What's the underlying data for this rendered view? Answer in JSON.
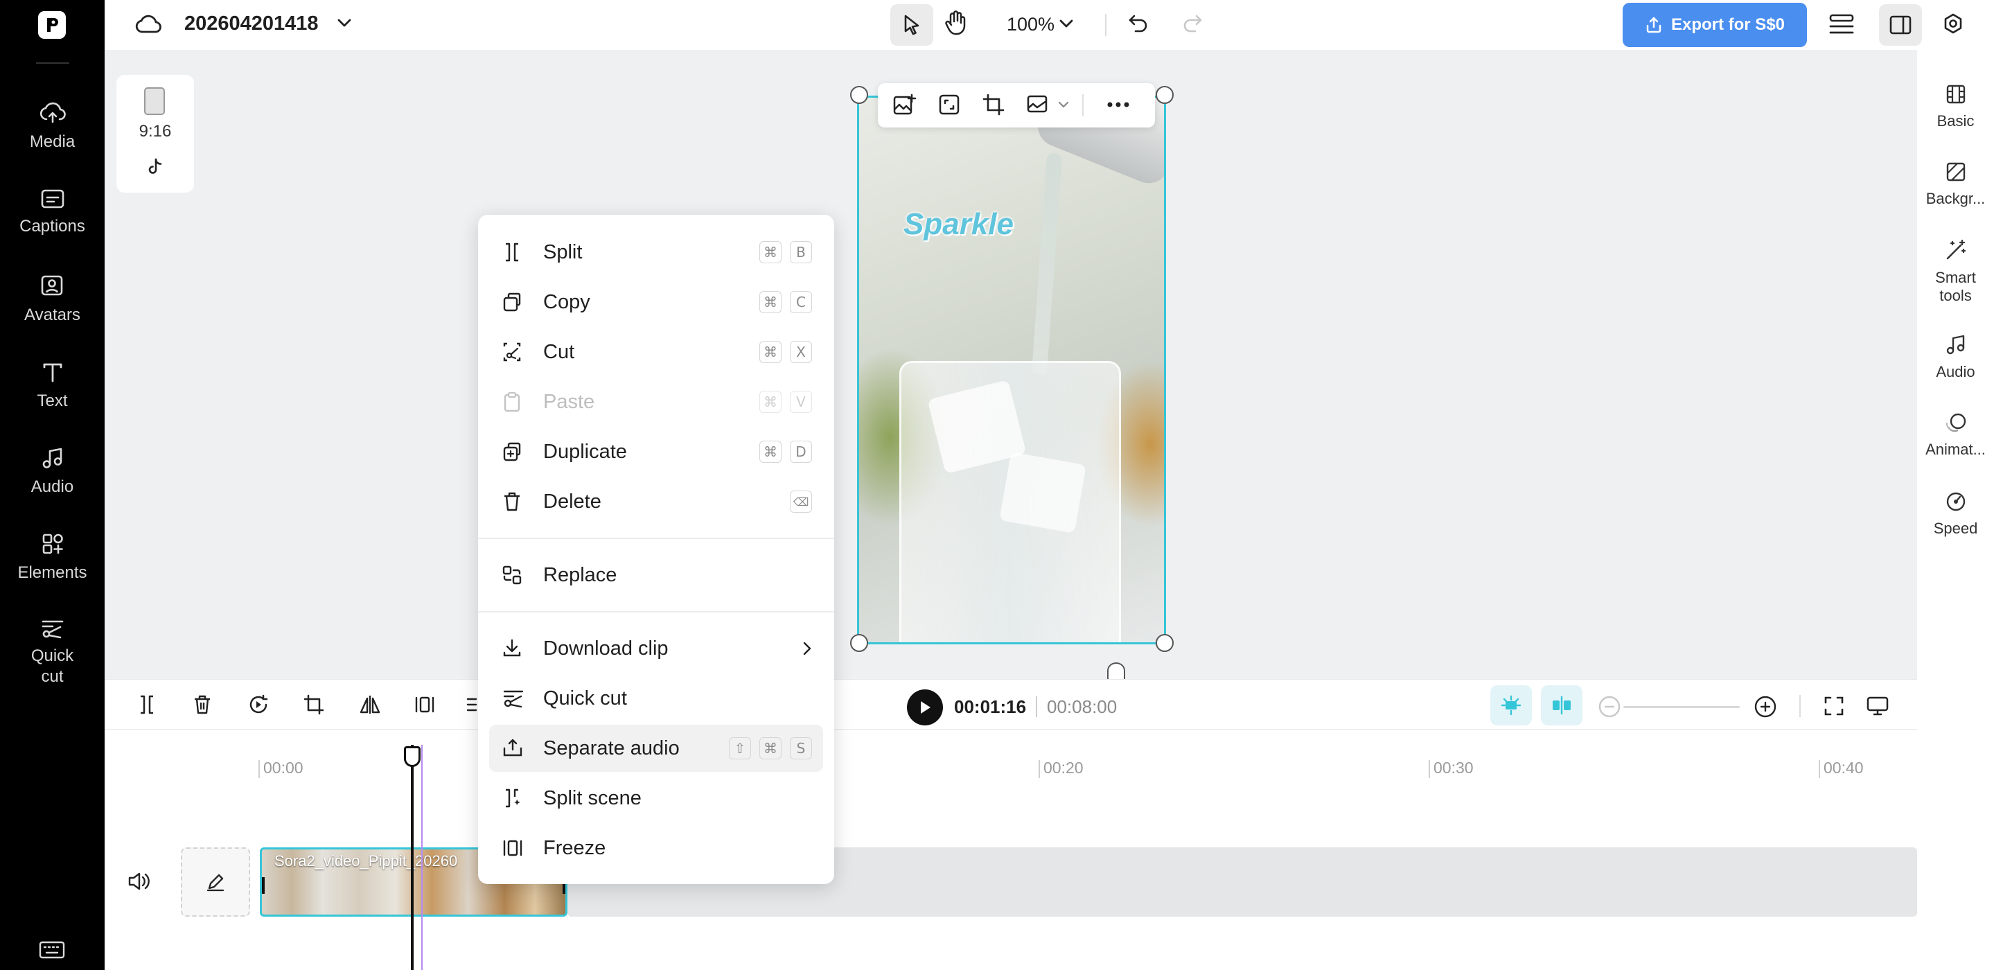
{
  "project": {
    "name": "202604201418"
  },
  "topbar": {
    "zoom": "100%",
    "export_label": "Export for S$0"
  },
  "left_sidebar": {
    "items": [
      {
        "label": "Media",
        "icon": "cloud-upload-icon"
      },
      {
        "label": "Captions",
        "icon": "captions-icon"
      },
      {
        "label": "Avatars",
        "icon": "avatar-icon"
      },
      {
        "label": "Text",
        "icon": "text-icon"
      },
      {
        "label": "Audio",
        "icon": "music-note-icon"
      },
      {
        "label": "Elements",
        "icon": "elements-icon"
      },
      {
        "label": "Quick\ncut",
        "icon": "quick-cut-icon"
      }
    ]
  },
  "right_sidebar": {
    "items": [
      {
        "label": "Basic",
        "icon": "film-icon"
      },
      {
        "label": "Backgr...",
        "icon": "background-icon"
      },
      {
        "label": "Smart\ntools",
        "icon": "magic-wand-icon"
      },
      {
        "label": "Audio",
        "icon": "music-note-icon"
      },
      {
        "label": "Animat...",
        "icon": "animation-icon"
      },
      {
        "label": "Speed",
        "icon": "speed-icon"
      }
    ]
  },
  "format_panel": {
    "ratio": "9:16"
  },
  "preview": {
    "overlay_text": "Sparkle"
  },
  "context_menu": {
    "items": [
      {
        "label": "Split",
        "keys": [
          "⌘",
          "B"
        ],
        "disabled": false
      },
      {
        "label": "Copy",
        "keys": [
          "⌘",
          "C"
        ],
        "disabled": false
      },
      {
        "label": "Cut",
        "keys": [
          "⌘",
          "X"
        ],
        "disabled": false
      },
      {
        "label": "Paste",
        "keys": [
          "⌘",
          "V"
        ],
        "disabled": true
      },
      {
        "label": "Duplicate",
        "keys": [
          "⌘",
          "D"
        ],
        "disabled": false
      },
      {
        "label": "Delete",
        "keys": [
          "⌫"
        ],
        "disabled": false
      },
      {
        "label": "Replace",
        "keys": [],
        "disabled": false
      },
      {
        "label": "Download clip",
        "keys": [],
        "disabled": false
      },
      {
        "label": "Quick cut",
        "keys": [],
        "disabled": false
      },
      {
        "label": "Separate audio",
        "keys": [
          "⇧",
          "⌘",
          "S"
        ],
        "disabled": false,
        "highlighted": true
      },
      {
        "label": "Split scene",
        "keys": [],
        "disabled": false
      },
      {
        "label": "Freeze",
        "keys": [],
        "disabled": false
      }
    ]
  },
  "player": {
    "current_time": "00:01:16",
    "total_time": "00:08:00"
  },
  "timeline": {
    "ruler": [
      "00:00",
      "00:20",
      "00:30",
      "00:40"
    ],
    "clip_name": "Sora2_video_Pippit_20260"
  },
  "colors": {
    "accent": "#2f86f6",
    "selection": "#35c5d8",
    "sidebar_bg": "#000000"
  }
}
